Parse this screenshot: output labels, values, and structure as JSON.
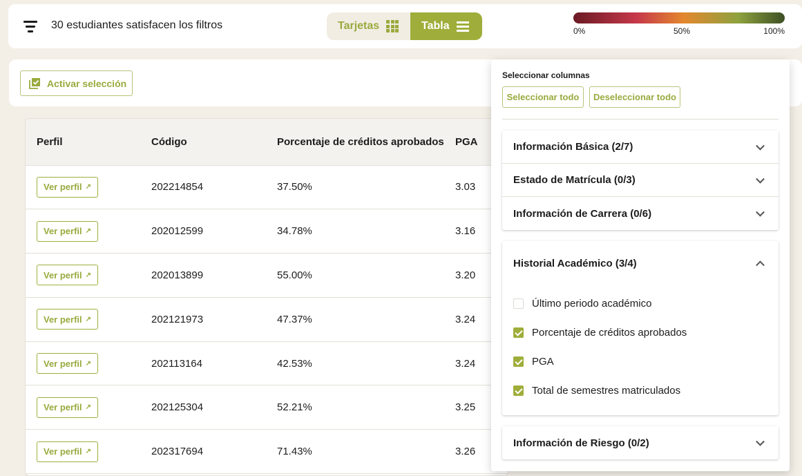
{
  "header": {
    "filter_count_text": "30 estudiantes satisfacen los filtros",
    "view_toggle": {
      "cards_label": "Tarjetas",
      "table_label": "Tabla",
      "active": "table"
    },
    "gradient_legend": {
      "min": "0%",
      "mid": "50%",
      "max": "100%",
      "colors": [
        "#6b1a24",
        "#c6384a",
        "#e3872e",
        "#8ea23f",
        "#3d4f24"
      ]
    }
  },
  "selection": {
    "activate_label": "Activar selección"
  },
  "table": {
    "columns": [
      "Perfil",
      "Código",
      "Porcentaje de créditos aprobados",
      "PGA"
    ],
    "profile_button_label": "Ver perfil",
    "rows": [
      {
        "code": "202214854",
        "pct": "37.50%",
        "pga": "3.03"
      },
      {
        "code": "202012599",
        "pct": "34.78%",
        "pga": "3.16"
      },
      {
        "code": "202013899",
        "pct": "55.00%",
        "pga": "3.20"
      },
      {
        "code": "202121973",
        "pct": "47.37%",
        "pga": "3.24"
      },
      {
        "code": "202113164",
        "pct": "42.53%",
        "pga": "3.24"
      },
      {
        "code": "202125304",
        "pct": "52.21%",
        "pga": "3.25"
      },
      {
        "code": "202317694",
        "pct": "71.43%",
        "pga": "3.26"
      }
    ]
  },
  "column_selector": {
    "title": "Seleccionar columnas",
    "select_all_label": "Seleccionar todo",
    "deselect_all_label": "Deseleccionar todo",
    "groups": [
      {
        "label": "Información Básica (2/7)",
        "expanded": false
      },
      {
        "label": "Estado de Matrícula (0/3)",
        "expanded": false
      },
      {
        "label": "Información de Carrera (0/6)",
        "expanded": false
      },
      {
        "label": "Historial Académico (3/4)",
        "expanded": true,
        "options": [
          {
            "label": "Último periodo académico",
            "checked": false
          },
          {
            "label": "Porcentaje de créditos aprobados",
            "checked": true
          },
          {
            "label": "PGA",
            "checked": true
          },
          {
            "label": "Total de semestres matriculados",
            "checked": true
          }
        ]
      },
      {
        "label": "Información de Riesgo (0/2)",
        "expanded": false
      }
    ]
  },
  "colors": {
    "accent": "#9fae3a",
    "accent_text": "#9aaa3e",
    "background": "#f3efe7"
  }
}
